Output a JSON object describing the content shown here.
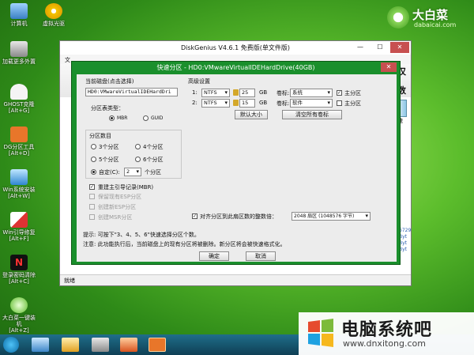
{
  "desktop": {
    "icons": [
      {
        "label": "计算机"
      },
      {
        "label": "虚拟光驱"
      },
      {
        "label": "加载更多外置"
      },
      {
        "label": "GHOST克隆",
        "sub": "[Alt+G]"
      },
      {
        "label": "DG分区工具",
        "sub": "[Alt+D]"
      },
      {
        "label": "Win系统安装",
        "sub": "[Alt+W]"
      },
      {
        "label": "Win引导修复",
        "sub": "[Alt+F]"
      },
      {
        "label": "登录密码清除",
        "sub": "[Alt+C]"
      },
      {
        "label": "大白菜一键装机",
        "sub": "[Alt+Z]"
      }
    ],
    "brand": {
      "name": "大白菜",
      "sub": "dabaicai.com"
    }
  },
  "window": {
    "title": "DiskGenius V4.6.1 免费版(单文件版)",
    "menu_partial": "文",
    "right_partial": [
      "仅",
      "数",
      "速"
    ],
    "status": "就绪",
    "side_partial": [
      "6729",
      "Byt",
      "Byt",
      "Byt"
    ]
  },
  "dialog": {
    "title": "快速分区 - HD0:VMwareVirtualIDEHardDrive(40GB)",
    "current_disk_label": "当前磁盘(点击选择)",
    "current_disk_value": "HD0:VMwareVirtualIDEHardDri",
    "table_type_label": "分区表类型：",
    "mbr": "MBR",
    "guid": "GUID",
    "count_label": "分区数目",
    "options": [
      "3个分区",
      "4个分区",
      "5个分区",
      "6个分区"
    ],
    "custom_label": "自定(C):",
    "custom_value": "2",
    "custom_suffix": "个分区",
    "rebuild_mbr": "重建主引导记录(MBR)",
    "keep_esp": "保留现有ESP分区",
    "create_esp": "创建新ESP分区",
    "create_msr": "创建MSR分区",
    "advanced_label": "高级设置",
    "partitions": [
      {
        "index": "1:",
        "fs": "NTFS",
        "size": "25",
        "unit": "GB",
        "vol_label": "卷标:",
        "name": "系统",
        "primary": "主分区",
        "primary_checked": true
      },
      {
        "index": "2:",
        "fs": "NTFS",
        "size": "15",
        "unit": "GB",
        "vol_label": "卷标:",
        "name": "软件",
        "primary": "主分区",
        "primary_checked": false
      }
    ],
    "default_size_btn": "默认大小",
    "clear_labels_btn": "清空所有卷标",
    "align_label": "对齐分区到此扇区数的整数倍：",
    "align_value": "2048 扇区 (1048576 字节)",
    "tip": "提示:  可按下\"3、4、5、6\"快速选择分区个数。",
    "warning": "注意:  此功能执行后，当前磁盘上的现有分区将被删除。新分区将会被快速格式化。",
    "ok": "确定",
    "cancel": "取消"
  },
  "watermark": {
    "name": "电脑系统吧",
    "url": "www.dnxitong.com"
  }
}
